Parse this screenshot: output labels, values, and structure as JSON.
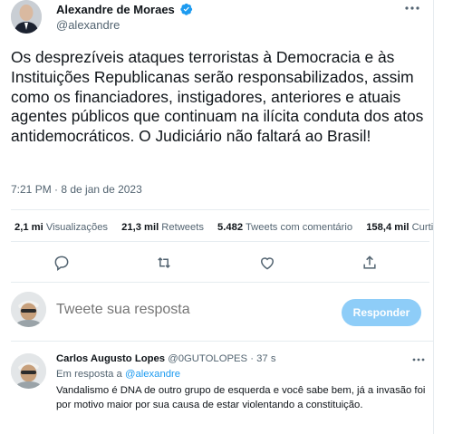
{
  "tweet": {
    "author_name": "Alexandre de Moraes",
    "author_handle": "@alexandre",
    "verified_icon": "verified-badge-icon",
    "text": "Os desprezíveis ataques terroristas à Democracia e às Instituições Republicanas serão responsabilizados, assim como os financiadores, instigadores, anteriores e atuais agentes públicos que continuam na ilícita conduta dos atos antidemocráticos. O Judiciário não faltará ao Brasil!",
    "timestamp": "7:21 PM · 8 de jan de 2023",
    "stats": [
      {
        "value": "2,1 mi",
        "label": "Visualizações"
      },
      {
        "value": "21,3 mil",
        "label": "Retweets"
      },
      {
        "value": "5.482",
        "label": "Tweets com comentário"
      },
      {
        "value": "158,4 mil",
        "label": "Curti"
      }
    ],
    "actions": [
      "reply-icon",
      "retweet-icon",
      "like-icon",
      "share-icon"
    ]
  },
  "composer": {
    "placeholder": "Tweete sua resposta",
    "button_label": "Responder",
    "button_color": "#8ecdf8"
  },
  "reply": {
    "author_name": "Carlos Augusto Lopes",
    "author_handle": "@0GUTOLOPES",
    "separator": "·",
    "age": "37 s",
    "in_reply_prefix": "Em resposta a",
    "in_reply_handle": "@alexandre",
    "text": "Vandalismo é DNA de outro grupo de esquerda e você sabe bem, já a invasão foi por motivo maior por sua causa de estar violentando a constituição."
  },
  "colors": {
    "accent": "#1d9bf0",
    "muted": "#536471",
    "text": "#0f1419"
  }
}
